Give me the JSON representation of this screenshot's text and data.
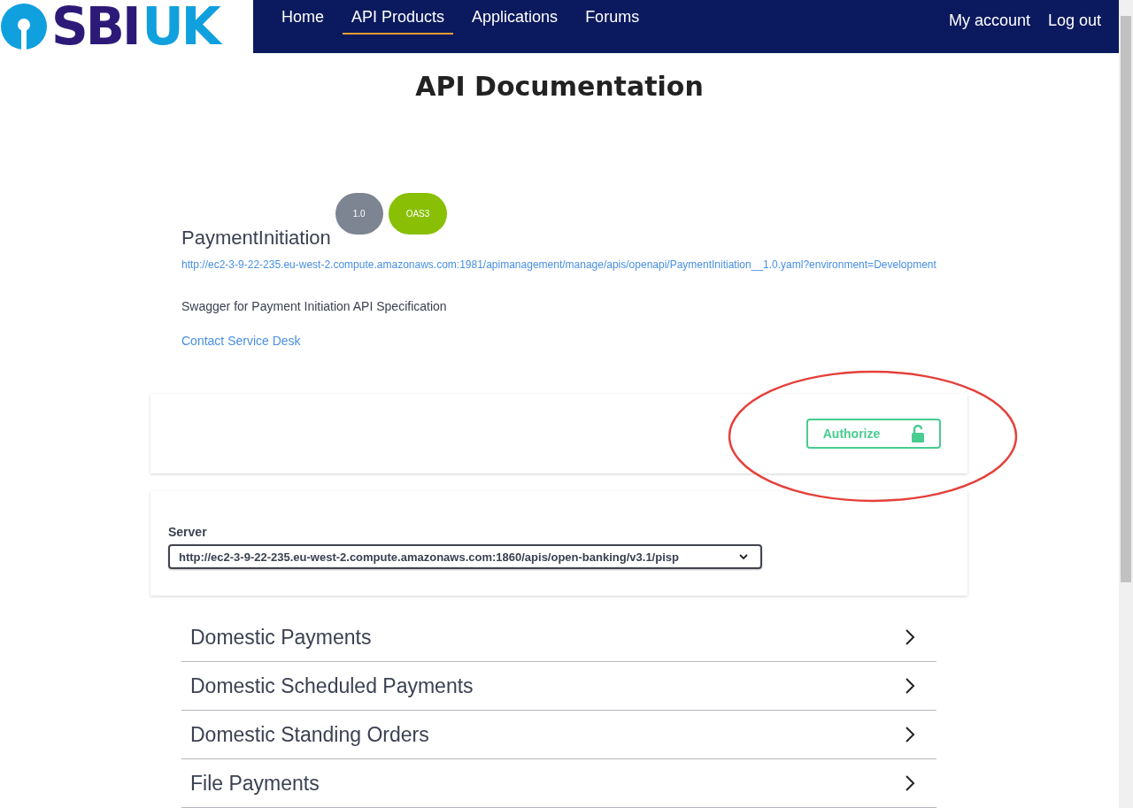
{
  "header": {
    "logo": {
      "mark": "SBI",
      "region": "UK"
    },
    "nav": [
      {
        "label": "Home",
        "selected": false
      },
      {
        "label": "API Products",
        "selected": true
      },
      {
        "label": "Applications",
        "selected": false
      },
      {
        "label": "Forums",
        "selected": false
      }
    ],
    "account_links": [
      "My account",
      "Log out"
    ]
  },
  "page_title": "API Documentation",
  "api": {
    "badges": [
      {
        "label": "1.0",
        "color": "#7d8492"
      },
      {
        "label": "OAS3",
        "color": "#89bf04"
      }
    ],
    "title": "PaymentInitiation",
    "spec_url": "http://ec2-3-9-22-235.eu-west-2.compute.amazonaws.com:1981/apimanagement/manage/apis/openapi/PaymentInitiation__1.0.yaml?environment=Development",
    "description": "Swagger for Payment Initiation API Specification",
    "contact": "Contact Service Desk"
  },
  "authorize": {
    "label": "Authorize",
    "highlighted": true
  },
  "server": {
    "label": "Server",
    "value": "http://ec2-3-9-22-235.eu-west-2.compute.amazonaws.com:1860/apis/open-banking/v3.1/pisp"
  },
  "sections": [
    {
      "title": "Domestic Payments",
      "expanded": false
    },
    {
      "title": "Domestic Scheduled Payments",
      "expanded": false
    },
    {
      "title": "Domestic Standing Orders",
      "expanded": false
    },
    {
      "title": "File Payments",
      "expanded": false
    }
  ]
}
